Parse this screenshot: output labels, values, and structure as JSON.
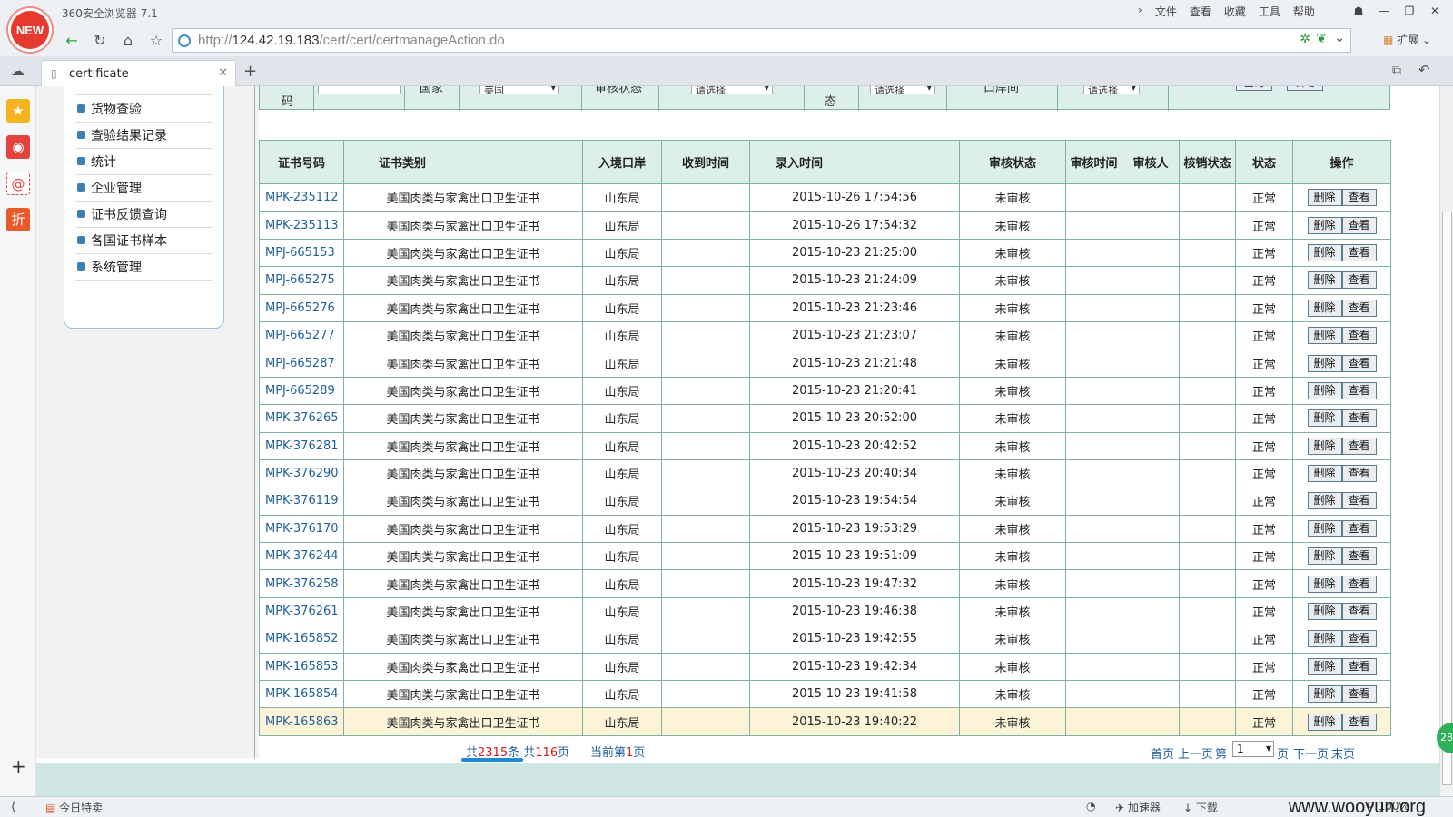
{
  "browser": {
    "logo": "NEW",
    "title": "360安全浏览器 7.1",
    "menus": [
      "文件",
      "查看",
      "收藏",
      "工具",
      "帮助"
    ],
    "url_scheme": "http://",
    "url_host": "124.42.19.183",
    "url_path": "/cert/cert/certmanageAction.do",
    "extensions_label": "扩展",
    "tab_title": "certificate"
  },
  "side_menu": {
    "items": [
      "货物查验",
      "查验结果记录",
      "统计",
      "企业管理",
      "证书反馈查询",
      "各国证书样本",
      "系统管理"
    ]
  },
  "filter": {
    "code_label": "码",
    "country_label": "国家",
    "country_value": "美国",
    "review_status_label": "审核状态",
    "review_status_value": "请选择",
    "state_label": "态",
    "state_value": "请选择",
    "port_label": "口岸间",
    "port_value": "请选择",
    "query_button": "查询",
    "add_button": "新增"
  },
  "table": {
    "headers": [
      "证书号码",
      "证书类别",
      "入境口岸",
      "收到时间",
      "录入时间",
      "审核状态",
      "审核时间",
      "审核人",
      "核销状态",
      "状态",
      "操作"
    ],
    "rows": [
      {
        "no": "MPK-235112",
        "type": "美国肉类与家禽出口卫生证书",
        "port": "山东局",
        "received": "",
        "entered": "2015-10-26 17:54:56",
        "review": "未审核",
        "review_time": "",
        "reviewer": "",
        "cancel": "",
        "status": "正常"
      },
      {
        "no": "MPK-235113",
        "type": "美国肉类与家禽出口卫生证书",
        "port": "山东局",
        "received": "",
        "entered": "2015-10-26 17:54:32",
        "review": "未审核",
        "review_time": "",
        "reviewer": "",
        "cancel": "",
        "status": "正常"
      },
      {
        "no": "MPJ-665153",
        "type": "美国肉类与家禽出口卫生证书",
        "port": "山东局",
        "received": "",
        "entered": "2015-10-23 21:25:00",
        "review": "未审核",
        "review_time": "",
        "reviewer": "",
        "cancel": "",
        "status": "正常"
      },
      {
        "no": "MPJ-665275",
        "type": "美国肉类与家禽出口卫生证书",
        "port": "山东局",
        "received": "",
        "entered": "2015-10-23 21:24:09",
        "review": "未审核",
        "review_time": "",
        "reviewer": "",
        "cancel": "",
        "status": "正常"
      },
      {
        "no": "MPJ-665276",
        "type": "美国肉类与家禽出口卫生证书",
        "port": "山东局",
        "received": "",
        "entered": "2015-10-23 21:23:46",
        "review": "未审核",
        "review_time": "",
        "reviewer": "",
        "cancel": "",
        "status": "正常"
      },
      {
        "no": "MPJ-665277",
        "type": "美国肉类与家禽出口卫生证书",
        "port": "山东局",
        "received": "",
        "entered": "2015-10-23 21:23:07",
        "review": "未审核",
        "review_time": "",
        "reviewer": "",
        "cancel": "",
        "status": "正常"
      },
      {
        "no": "MPJ-665287",
        "type": "美国肉类与家禽出口卫生证书",
        "port": "山东局",
        "received": "",
        "entered": "2015-10-23 21:21:48",
        "review": "未审核",
        "review_time": "",
        "reviewer": "",
        "cancel": "",
        "status": "正常"
      },
      {
        "no": "MPJ-665289",
        "type": "美国肉类与家禽出口卫生证书",
        "port": "山东局",
        "received": "",
        "entered": "2015-10-23 21:20:41",
        "review": "未审核",
        "review_time": "",
        "reviewer": "",
        "cancel": "",
        "status": "正常"
      },
      {
        "no": "MPK-376265",
        "type": "美国肉类与家禽出口卫生证书",
        "port": "山东局",
        "received": "",
        "entered": "2015-10-23 20:52:00",
        "review": "未审核",
        "review_time": "",
        "reviewer": "",
        "cancel": "",
        "status": "正常"
      },
      {
        "no": "MPK-376281",
        "type": "美国肉类与家禽出口卫生证书",
        "port": "山东局",
        "received": "",
        "entered": "2015-10-23 20:42:52",
        "review": "未审核",
        "review_time": "",
        "reviewer": "",
        "cancel": "",
        "status": "正常"
      },
      {
        "no": "MPK-376290",
        "type": "美国肉类与家禽出口卫生证书",
        "port": "山东局",
        "received": "",
        "entered": "2015-10-23 20:40:34",
        "review": "未审核",
        "review_time": "",
        "reviewer": "",
        "cancel": "",
        "status": "正常"
      },
      {
        "no": "MPK-376119",
        "type": "美国肉类与家禽出口卫生证书",
        "port": "山东局",
        "received": "",
        "entered": "2015-10-23 19:54:54",
        "review": "未审核",
        "review_time": "",
        "reviewer": "",
        "cancel": "",
        "status": "正常"
      },
      {
        "no": "MPK-376170",
        "type": "美国肉类与家禽出口卫生证书",
        "port": "山东局",
        "received": "",
        "entered": "2015-10-23 19:53:29",
        "review": "未审核",
        "review_time": "",
        "reviewer": "",
        "cancel": "",
        "status": "正常"
      },
      {
        "no": "MPK-376244",
        "type": "美国肉类与家禽出口卫生证书",
        "port": "山东局",
        "received": "",
        "entered": "2015-10-23 19:51:09",
        "review": "未审核",
        "review_time": "",
        "reviewer": "",
        "cancel": "",
        "status": "正常"
      },
      {
        "no": "MPK-376258",
        "type": "美国肉类与家禽出口卫生证书",
        "port": "山东局",
        "received": "",
        "entered": "2015-10-23 19:47:32",
        "review": "未审核",
        "review_time": "",
        "reviewer": "",
        "cancel": "",
        "status": "正常"
      },
      {
        "no": "MPK-376261",
        "type": "美国肉类与家禽出口卫生证书",
        "port": "山东局",
        "received": "",
        "entered": "2015-10-23 19:46:38",
        "review": "未审核",
        "review_time": "",
        "reviewer": "",
        "cancel": "",
        "status": "正常"
      },
      {
        "no": "MPK-165852",
        "type": "美国肉类与家禽出口卫生证书",
        "port": "山东局",
        "received": "",
        "entered": "2015-10-23 19:42:55",
        "review": "未审核",
        "review_time": "",
        "reviewer": "",
        "cancel": "",
        "status": "正常"
      },
      {
        "no": "MPK-165853",
        "type": "美国肉类与家禽出口卫生证书",
        "port": "山东局",
        "received": "",
        "entered": "2015-10-23 19:42:34",
        "review": "未审核",
        "review_time": "",
        "reviewer": "",
        "cancel": "",
        "status": "正常"
      },
      {
        "no": "MPK-165854",
        "type": "美国肉类与家禽出口卫生证书",
        "port": "山东局",
        "received": "",
        "entered": "2015-10-23 19:41:58",
        "review": "未审核",
        "review_time": "",
        "reviewer": "",
        "cancel": "",
        "status": "正常"
      },
      {
        "no": "MPK-165863",
        "type": "美国肉类与家禽出口卫生证书",
        "port": "山东局",
        "received": "",
        "entered": "2015-10-23 19:40:22",
        "review": "未审核",
        "review_time": "",
        "reviewer": "",
        "cancel": "",
        "status": "正常"
      }
    ],
    "delete_label": "删除",
    "view_label": "查看",
    "highlighted_row": 19
  },
  "pager": {
    "total_prefix": "共",
    "total_records": "2315",
    "records_suffix": "条",
    "pages_prefix": "共",
    "total_pages": "116",
    "pages_suffix": "页",
    "current_prefix": "当前第",
    "current_page": "1",
    "current_suffix": "页",
    "first": "首页",
    "prev": "上一页",
    "goto_prefix": "第",
    "goto_value": "1",
    "goto_suffix": "页",
    "next": "下一页",
    "last": "末页"
  },
  "statusbar": {
    "deals": "今日特卖",
    "accelerator": "加速器",
    "download": "下载",
    "zoom": "100%",
    "watermark": "www.wooyun.org"
  },
  "colors": {
    "header_bg": "#dcefeb",
    "border": "#7fb0a4",
    "link": "#1f5e9e",
    "highlight_row": "#fdf4d8",
    "pager_number": "#d21d1d"
  }
}
